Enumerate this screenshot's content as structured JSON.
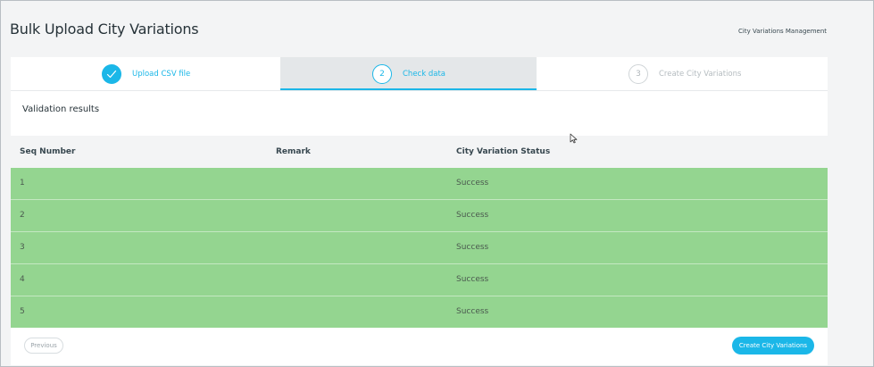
{
  "page": {
    "title": "Bulk Upload City Variations",
    "breadcrumb": "City Variations Management"
  },
  "stepper": {
    "steps": [
      {
        "label": "Upload CSV file",
        "number": "1",
        "state": "done",
        "icon": "check-icon"
      },
      {
        "label": "Check data",
        "number": "2",
        "state": "current"
      },
      {
        "label": "Create City Variations",
        "number": "3",
        "state": "pending"
      }
    ]
  },
  "section": {
    "title": "Validation results"
  },
  "table": {
    "columns": [
      "Seq Number",
      "Remark",
      "City Variation Status"
    ],
    "rows": [
      {
        "seq": "1",
        "remark": "",
        "status": "Success"
      },
      {
        "seq": "2",
        "remark": "",
        "status": "Success"
      },
      {
        "seq": "3",
        "remark": "",
        "status": "Success"
      },
      {
        "seq": "4",
        "remark": "",
        "status": "Success"
      },
      {
        "seq": "5",
        "remark": "",
        "status": "Success"
      }
    ]
  },
  "actions": {
    "previous_label": "Previous",
    "create_label": "Create City Variations"
  },
  "colors": {
    "accent": "#1bb7e8",
    "success_row": "#94d590",
    "header_bg": "#f3f4f5"
  }
}
